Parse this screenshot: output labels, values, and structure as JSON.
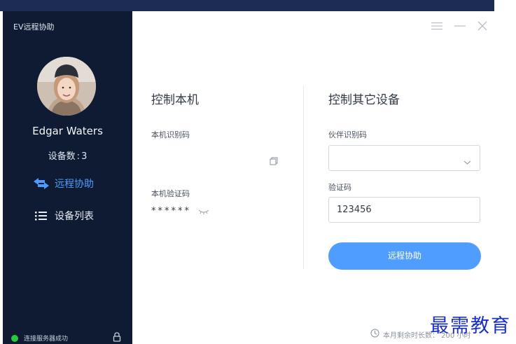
{
  "app": {
    "title": "EV远程协助"
  },
  "user": {
    "name": "Edgar Waters",
    "device_count_label": "设备数",
    "device_count_sep": ":",
    "device_count": "3"
  },
  "nav": [
    {
      "label": "远程协助",
      "icon": "swap-arrows-icon",
      "active": true
    },
    {
      "label": "设备列表",
      "icon": "list-icon",
      "active": false
    }
  ],
  "status": {
    "text": "连接服务器成功",
    "color": "#27c93f"
  },
  "local": {
    "title": "控制本机",
    "id_label": "本机识别码",
    "id_value": "",
    "code_label": "本机验证码",
    "code_value": "******"
  },
  "remote": {
    "title": "控制其它设备",
    "partner_label": "伙伴识别码",
    "partner_value": "",
    "code_label": "验证码",
    "code_value": "123456",
    "button_label": "远程协助"
  },
  "footer": {
    "quota_text": "本月剩余时长数：  200 小时"
  },
  "watermark": "最需教育",
  "colors": {
    "sidebar": "#0f1b33",
    "accent": "#4f9eff",
    "active_nav": "#4e9bff"
  }
}
